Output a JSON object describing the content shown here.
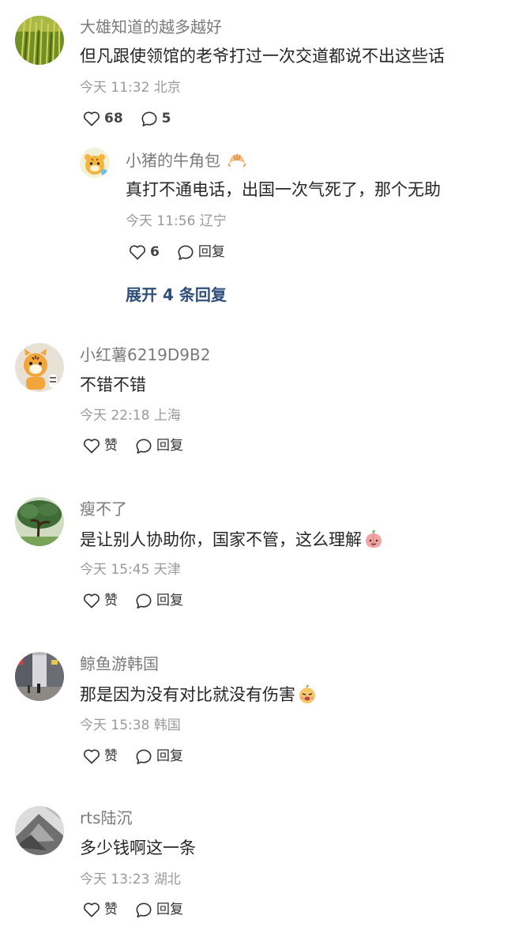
{
  "comments": [
    {
      "username": "大雄知道的越多越好",
      "text": "但凡跟使领馆的老爷打过一次交道都说不出这些话",
      "time": "今天 11:32",
      "location": "北京",
      "likes": "68",
      "replies_count": "5",
      "avatar_icon": "wheat-field-avatar-icon",
      "reply": {
        "username": "小猪的牛角包",
        "username_emoji": "croissant-icon",
        "text": "真打不通电话，出国一次气死了，那个无助",
        "time": "今天 11:56",
        "location": "辽宁",
        "likes": "6",
        "reply_label": "回复"
      },
      "expand_label": "展开 4 条回复"
    },
    {
      "username": "小红薯6219D9B2",
      "text": "不错不错",
      "time": "今天 22:18",
      "location": "上海",
      "like_label": "赞",
      "reply_label": "回复"
    },
    {
      "username": "瘦不了",
      "text": "是让别人协助你，国家不管，这么理解",
      "text_emoji": "peach-face-emoji",
      "time": "今天 15:45",
      "location": "天津",
      "like_label": "赞",
      "reply_label": "回复"
    },
    {
      "username": "鲸鱼游韩国",
      "text": "那是因为没有对比就没有伤害",
      "text_emoji": "sly-face-emoji",
      "time": "今天 15:38",
      "location": "韩国",
      "like_label": "赞",
      "reply_label": "回复"
    },
    {
      "username": "rts陆沉",
      "text": "多少钱啊这一条",
      "time": "今天 13:23",
      "location": "湖北",
      "like_label": "赞",
      "reply_label": "回复"
    }
  ],
  "colors": {
    "username": "#7b7b7b",
    "text": "#262626",
    "meta": "#9a9a9a",
    "expand_link": "#2f4e7a"
  }
}
